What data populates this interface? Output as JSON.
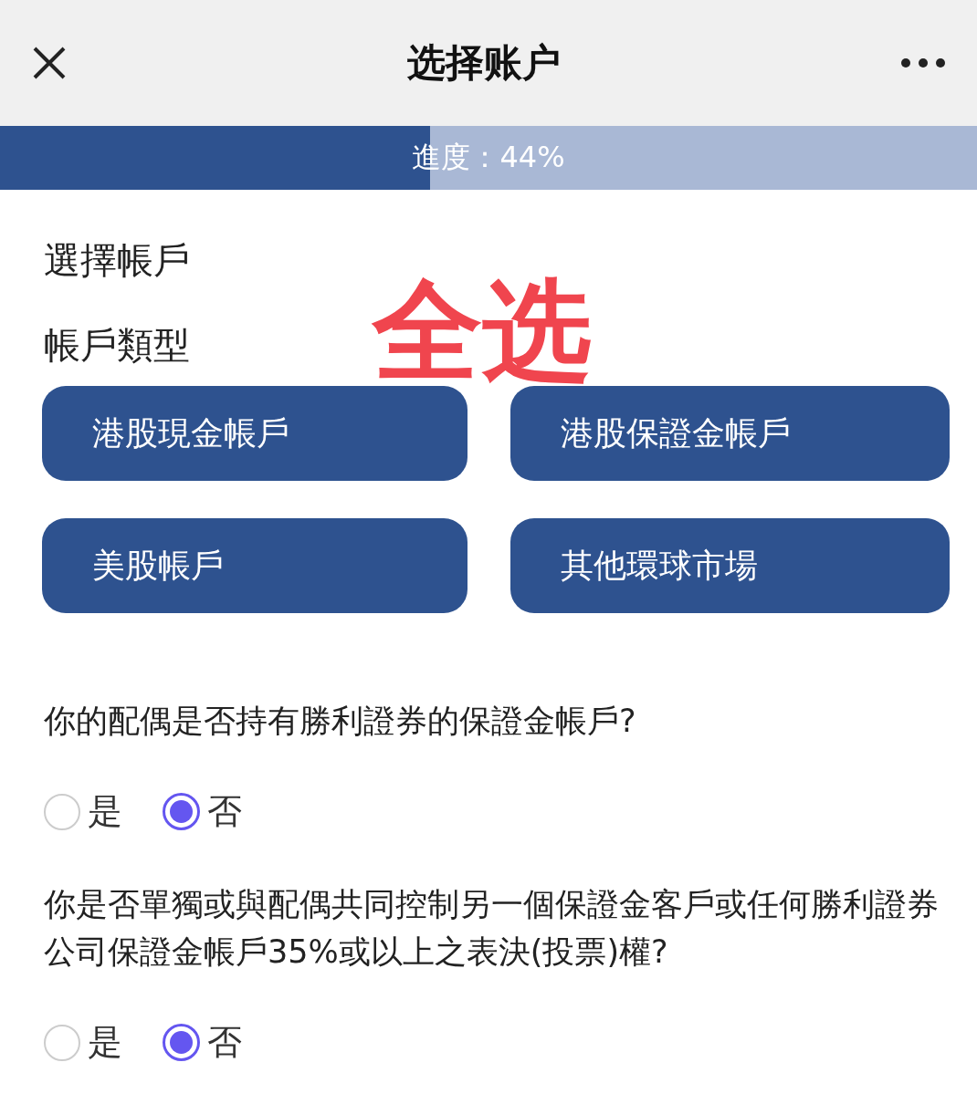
{
  "header": {
    "title": "选择账户"
  },
  "progress": {
    "label": "進度：44%",
    "level": 0.44
  },
  "section_title": "選擇帳戶",
  "account_type_label": "帳戶類型",
  "annotation": "全选",
  "account_types": [
    {
      "label": "港股現金帳戶",
      "selected": true
    },
    {
      "label": "港股保證金帳戶",
      "selected": true
    },
    {
      "label": "美股帳戶",
      "selected": true
    },
    {
      "label": "其他環球市場",
      "selected": true
    }
  ],
  "questions": [
    {
      "text": "你的配偶是否持有勝利證券的保證金帳戶?",
      "options": [
        {
          "label": "是",
          "selected": false
        },
        {
          "label": "否",
          "selected": true
        }
      ]
    },
    {
      "text": "你是否單獨或與配偶共同控制另一個保證金客戶或任何勝利證券公司保證金帳戶35%或以上之表決(投票)權?",
      "options": [
        {
          "label": "是",
          "selected": false
        },
        {
          "label": "否",
          "selected": true
        }
      ]
    }
  ]
}
